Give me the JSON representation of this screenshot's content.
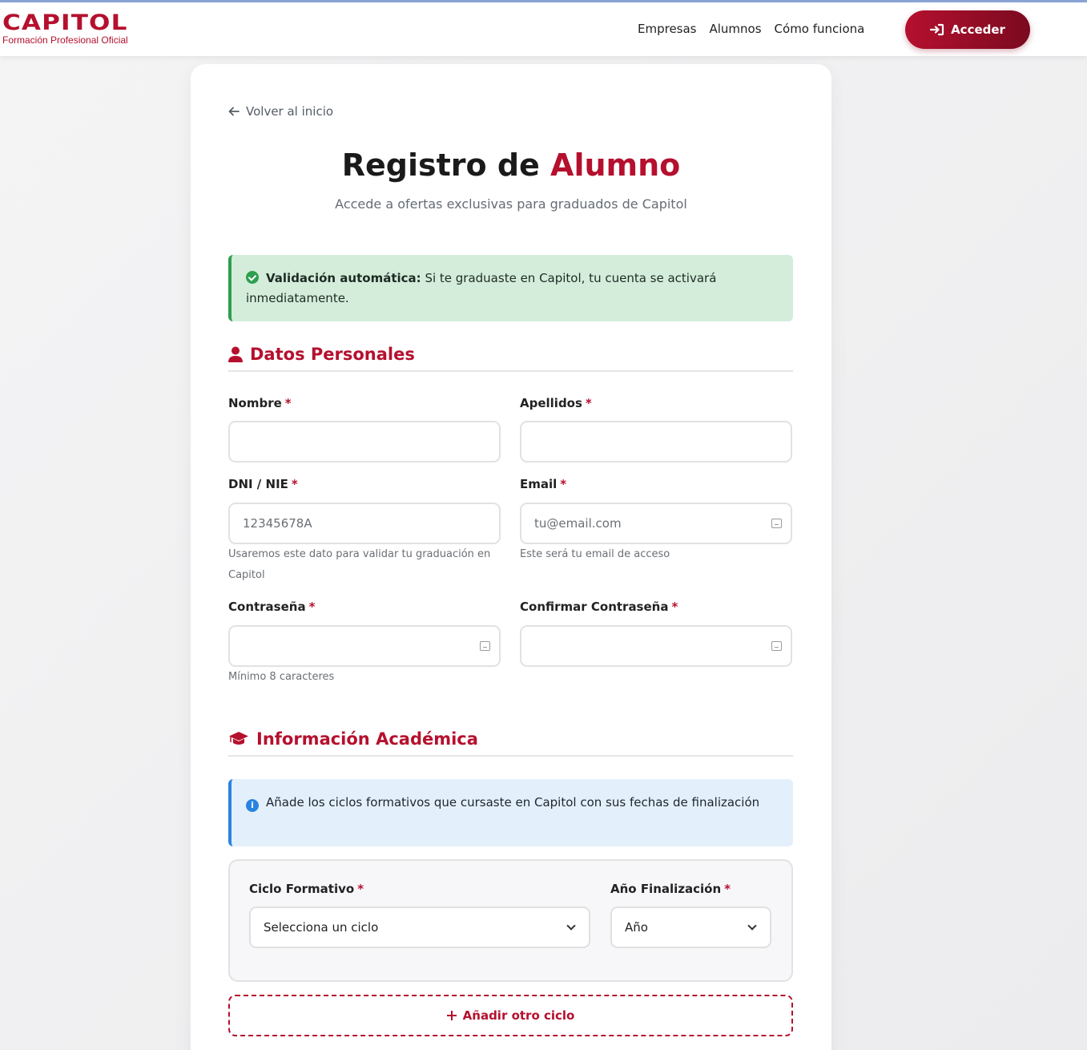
{
  "header": {
    "logo_text": "CAPITOL",
    "logo_subtitle": "Formación Profesional Oficial",
    "nav": [
      "Empresas",
      "Alumnos",
      "Cómo funciona"
    ],
    "login_label": "Acceder"
  },
  "colors": {
    "accent": "#b5102e",
    "success": "#2e9e4f",
    "info": "#2b83e0"
  },
  "page": {
    "back_label": "Volver al inicio",
    "title_prefix": "Registro de",
    "title_accent": "Alumno",
    "subtitle": "Accede a ofertas exclusivas para graduados de Capitol"
  },
  "success_alert": {
    "strong": "Validación automática:",
    "text": "Si te graduaste en Capitol, tu cuenta se activará inmediatamente."
  },
  "personal": {
    "heading": "Datos Personales",
    "required_mark": "*",
    "nombre": {
      "label": "Nombre",
      "placeholder": ""
    },
    "apellidos": {
      "label": "Apellidos",
      "placeholder": ""
    },
    "dni": {
      "label": "DNI / NIE",
      "placeholder": "12345678A",
      "hint": "Usaremos este dato para validar tu graduación en Capitol"
    },
    "email": {
      "label": "Email",
      "placeholder": "tu@email.com",
      "hint": "Este será tu email de acceso"
    },
    "password": {
      "label": "Contraseña",
      "placeholder": "",
      "hint": "Mínimo 8 caracteres"
    },
    "confirm_password": {
      "label": "Confirmar Contraseña",
      "placeholder": ""
    }
  },
  "academic": {
    "heading": "Información Académica",
    "info_text": "Añade los ciclos formativos que cursaste en Capitol con sus fechas de finalización",
    "ciclo": {
      "label": "Ciclo Formativo",
      "selected": "Selecciona un ciclo"
    },
    "anio": {
      "label": "Año Finalización",
      "selected": "Año"
    },
    "add_label": "Añadir otro ciclo"
  }
}
